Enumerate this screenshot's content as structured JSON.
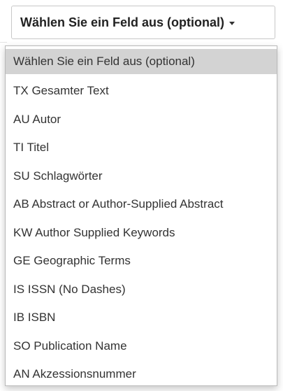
{
  "field_select": {
    "label": "Wählen Sie ein Feld aus (optional)",
    "caret_icon": "caret-down-icon",
    "selected_index": 0,
    "options": [
      "Wählen Sie ein Feld aus (optional)",
      "TX Gesamter Text",
      "AU Autor",
      "TI Titel",
      "SU Schlagwörter",
      "AB Abstract or Author-Supplied Abstract",
      "KW Author Supplied Keywords",
      "GE Geographic Terms",
      "IS ISSN (No Dashes)",
      "IB ISBN",
      "SO Publication Name",
      "AN Akzessionsnummer"
    ]
  },
  "colors": {
    "selected_background": "#d3d3d3",
    "text": "#333333",
    "border": "#b9b9b9"
  }
}
